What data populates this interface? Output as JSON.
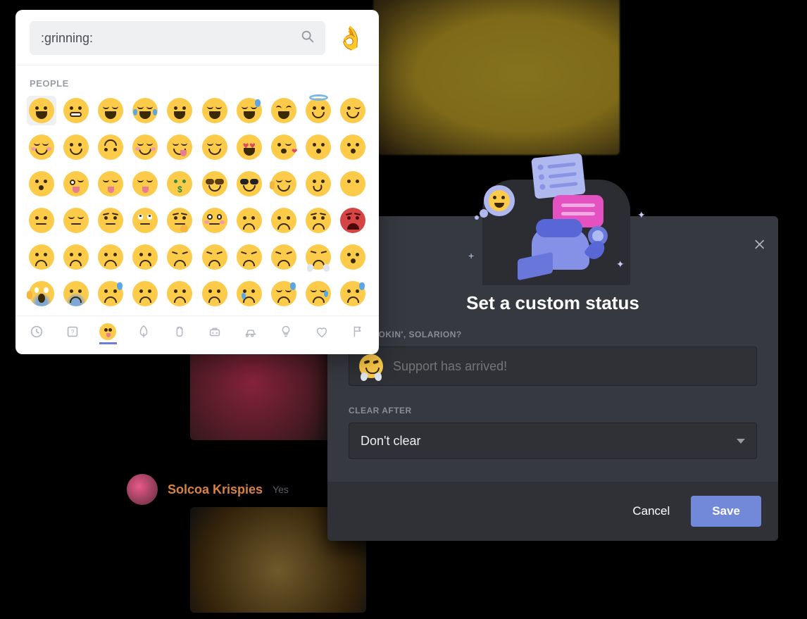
{
  "bg": {
    "username": "Solcoa Krispies",
    "timestamp_partial": "Yes"
  },
  "status_modal": {
    "title": "Set a custom status",
    "prompt_label": "WHAT'S COOKIN', SOLARION?",
    "prompt_label_visible": "T'S COOKIN', SOLARION?",
    "input_placeholder": "Support has arrived!",
    "input_value": "",
    "selected_emoji": "triumph",
    "clear_label": "CLEAR AFTER",
    "clear_value": "Don't clear",
    "cancel": "Cancel",
    "save": "Save"
  },
  "emoji_picker": {
    "search_value": ":grinning:",
    "skin_tone_preview": "ok_hand",
    "category_label": "PEOPLE",
    "selected_index": 0,
    "emojis": [
      "grinning",
      "grimacing",
      "grin",
      "joy",
      "smiley",
      "smile",
      "sweat_smile",
      "laughing",
      "innocent",
      "wink",
      "blush",
      "slight_smile",
      "upside_down",
      "relaxed",
      "yum",
      "relieved",
      "heart_eyes",
      "kissing_heart",
      "kissing",
      "kissing_smiling_eyes",
      "kissing_closed_eyes",
      "stuck_out_tongue_winking_eye",
      "stuck_out_tongue_closed_eyes",
      "stuck_out_tongue",
      "money_mouth",
      "nerd",
      "sunglasses",
      "hugging",
      "smirk",
      "no_mouth",
      "neutral_face",
      "expressionless",
      "unamused",
      "rolling_eyes",
      "thinking",
      "flushed",
      "disappointed",
      "worried",
      "angry",
      "rage",
      "pensive",
      "confused",
      "slight_frown",
      "frowning2",
      "persevere",
      "confounded",
      "tired_face",
      "weary",
      "triumph",
      "open_mouth",
      "scream",
      "fearful",
      "cold_sweat",
      "hushed",
      "frowning",
      "anguished",
      "cry",
      "disappointed_relieved",
      "sleepy",
      "sweat"
    ],
    "categories": [
      {
        "id": "recent",
        "active": false
      },
      {
        "id": "custom",
        "active": false
      },
      {
        "id": "people",
        "active": true
      },
      {
        "id": "nature",
        "active": false
      },
      {
        "id": "food",
        "active": false
      },
      {
        "id": "activity",
        "active": false
      },
      {
        "id": "travel",
        "active": false
      },
      {
        "id": "objects",
        "active": false
      },
      {
        "id": "symbols",
        "active": false
      },
      {
        "id": "flags",
        "active": false
      }
    ]
  }
}
